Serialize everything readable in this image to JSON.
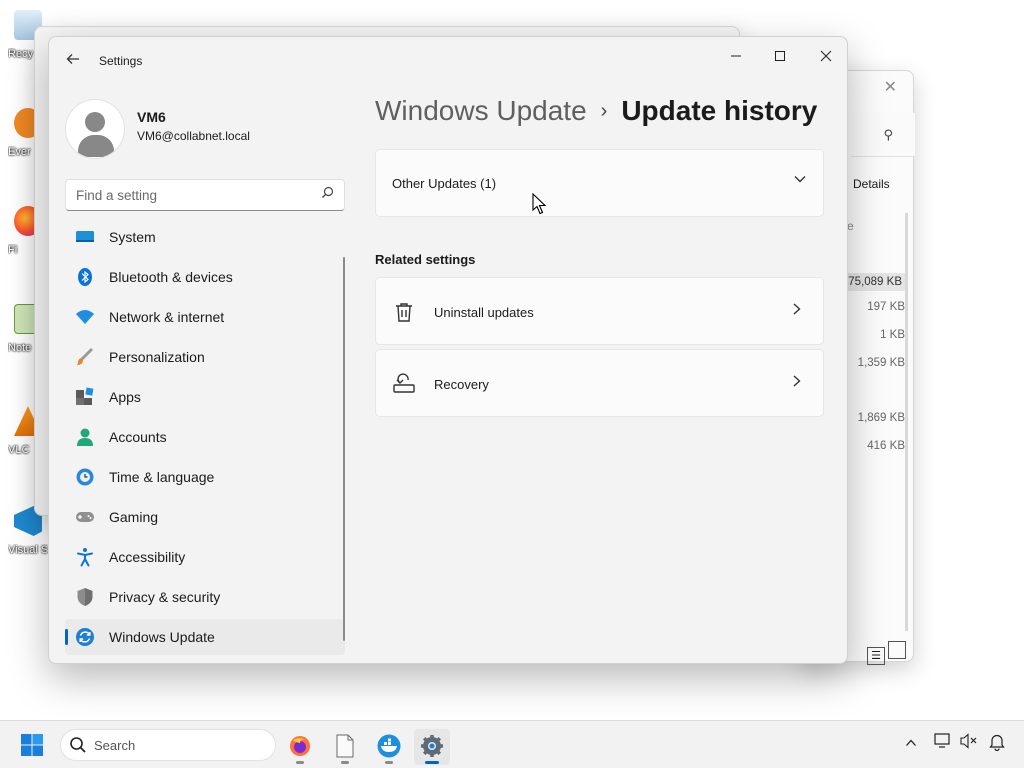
{
  "desktop": {
    "icons": [
      {
        "label": "Recy",
        "name": "recycle-bin"
      },
      {
        "label": "Ever",
        "name": "everything"
      },
      {
        "label": "Fi",
        "name": "firefox"
      },
      {
        "label": "Note",
        "name": "notepad-plus-plus"
      },
      {
        "label": "VLC",
        "name": "vlc"
      },
      {
        "label": "Visual S",
        "name": "visual-studio-code"
      }
    ]
  },
  "explorer": {
    "details_label": "Details",
    "column_fragment": "e",
    "sizes": [
      "75,089 KB",
      "197 KB",
      "1 KB",
      "1,359 KB",
      "1,869 KB",
      "416 KB"
    ]
  },
  "settings": {
    "app_title": "Settings",
    "user": {
      "name": "VM6",
      "email": "VM6@collabnet.local"
    },
    "search_placeholder": "Find a setting",
    "nav": [
      {
        "label": "System",
        "icon": "system-icon"
      },
      {
        "label": "Bluetooth & devices",
        "icon": "bluetooth-icon"
      },
      {
        "label": "Network & internet",
        "icon": "wifi-icon"
      },
      {
        "label": "Personalization",
        "icon": "brush-icon"
      },
      {
        "label": "Apps",
        "icon": "apps-icon"
      },
      {
        "label": "Accounts",
        "icon": "accounts-icon"
      },
      {
        "label": "Time & language",
        "icon": "globe-clock-icon"
      },
      {
        "label": "Gaming",
        "icon": "gamepad-icon"
      },
      {
        "label": "Accessibility",
        "icon": "accessibility-icon"
      },
      {
        "label": "Privacy & security",
        "icon": "shield-icon"
      },
      {
        "label": "Windows Update",
        "icon": "windows-update-icon",
        "active": true
      }
    ],
    "breadcrumb": {
      "parent": "Windows Update",
      "separator": "›",
      "current": "Update history"
    },
    "other_updates_label": "Other Updates (1)",
    "related_settings_title": "Related settings",
    "related": [
      {
        "label": "Uninstall updates",
        "icon": "trash-icon"
      },
      {
        "label": "Recovery",
        "icon": "recovery-icon"
      }
    ]
  },
  "taskbar": {
    "search_label": "Search",
    "apps": [
      "firefox",
      "file",
      "docker",
      "settings"
    ],
    "active_app": "settings"
  },
  "colors": {
    "accent": "#0067c0"
  }
}
